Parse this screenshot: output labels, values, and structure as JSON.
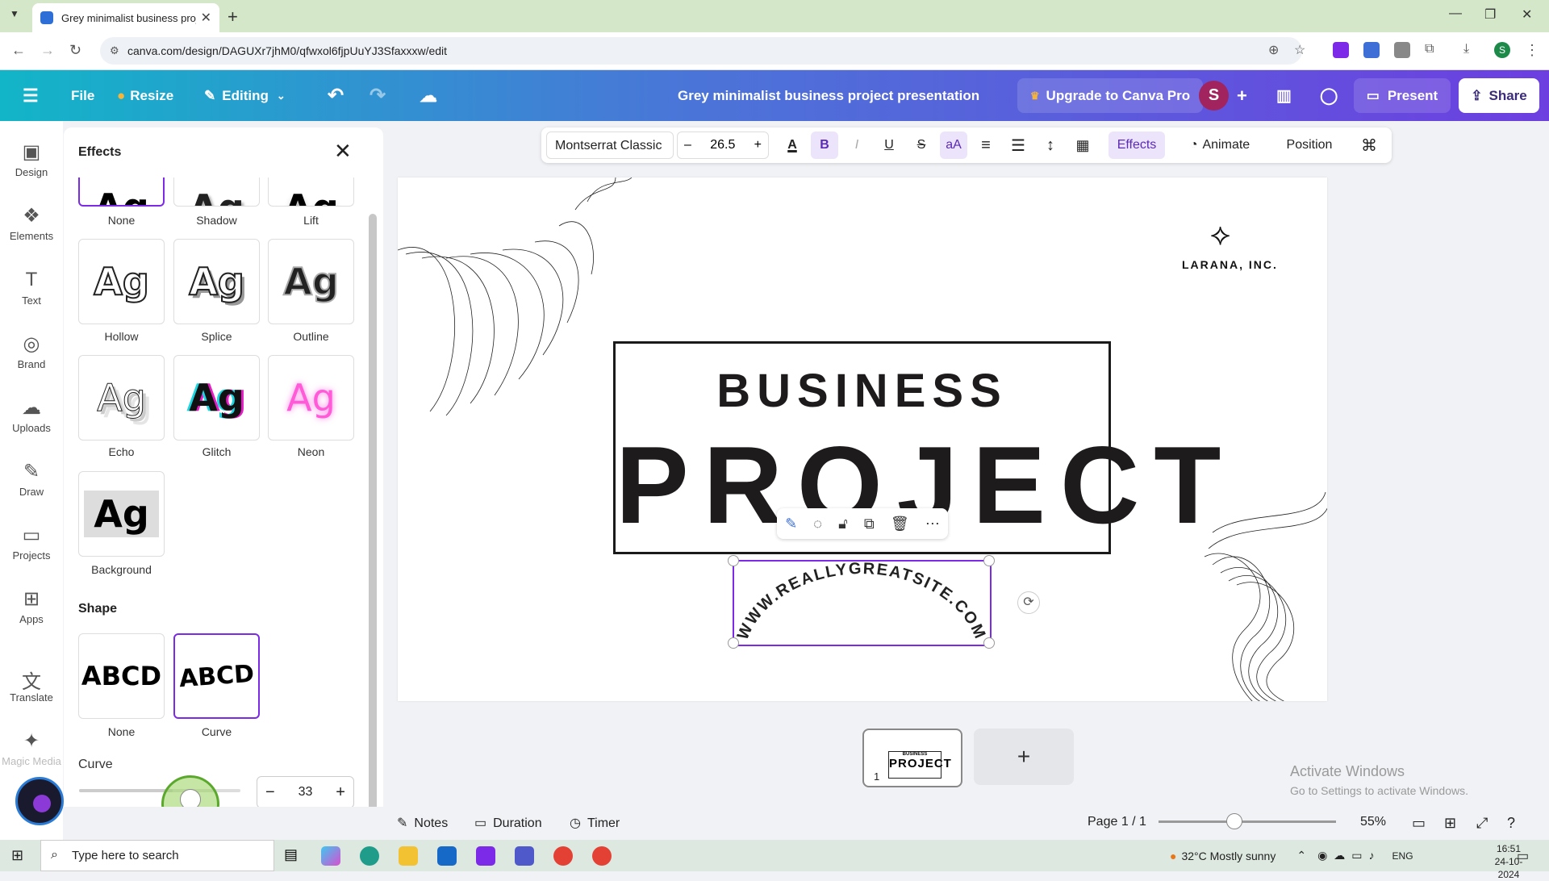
{
  "browser": {
    "tab_title": "Grey minimalist business project",
    "url": "canva.com/design/DAGUXr7jhM0/qfwxol6fjpUuYJ3Sfaxxxw/edit"
  },
  "header": {
    "file": "File",
    "resize": "Resize",
    "editing": "Editing",
    "doc_title": "Grey minimalist business project presentation",
    "upgrade": "Upgrade to Canva Pro",
    "avatar": "S",
    "present": "Present",
    "share": "Share"
  },
  "rail": [
    {
      "label": "Design",
      "icon": "▣"
    },
    {
      "label": "Elements",
      "icon": "❖"
    },
    {
      "label": "Text",
      "icon": "T"
    },
    {
      "label": "Brand",
      "icon": "◎"
    },
    {
      "label": "Uploads",
      "icon": "☁"
    },
    {
      "label": "Draw",
      "icon": "✎"
    },
    {
      "label": "Projects",
      "icon": "▭"
    },
    {
      "label": "Apps",
      "icon": "⊞"
    },
    {
      "label": "Translate",
      "icon": "文"
    },
    {
      "label": "Magic Media",
      "icon": "✦"
    }
  ],
  "panel": {
    "title": "Effects",
    "effects": [
      {
        "label": "None",
        "glyph": "Ag"
      },
      {
        "label": "Shadow",
        "glyph": "Ag"
      },
      {
        "label": "Lift",
        "glyph": "Ag"
      },
      {
        "label": "Hollow",
        "glyph": "Ag"
      },
      {
        "label": "Splice",
        "glyph": "Ag"
      },
      {
        "label": "Outline",
        "glyph": "Ag"
      },
      {
        "label": "Echo",
        "glyph": "Ag"
      },
      {
        "label": "Glitch",
        "glyph": "Ag"
      },
      {
        "label": "Neon",
        "glyph": "Ag"
      },
      {
        "label": "Background",
        "glyph": "Ag"
      }
    ],
    "shape_heading": "Shape",
    "shapes": [
      {
        "label": "None",
        "glyph": "ABCD"
      },
      {
        "label": "Curve",
        "glyph": "ABCD"
      }
    ],
    "curve_heading": "Curve",
    "curve_value": "33",
    "curve_fraction": 0.58
  },
  "toolbar": {
    "font": "Montserrat Classic",
    "size": "26.5",
    "effects": "Effects",
    "animate": "Animate",
    "position": "Position"
  },
  "canvas": {
    "logo_text": "LARANA, INC.",
    "title_line1": "BUSINESS",
    "title_line2": "PROJECT",
    "curved_text": "WWW.REALLYGREATSITE.COM"
  },
  "thumbnail": {
    "line1": "BUSINESS",
    "line2": "PROJECT",
    "number": "1"
  },
  "footer": {
    "notes": "Notes",
    "duration": "Duration",
    "timer": "Timer",
    "page": "Page 1 / 1",
    "zoom": "55%"
  },
  "watermark": {
    "line1": "Activate Windows",
    "line2": "Go to Settings to activate Windows."
  },
  "taskbar": {
    "search_placeholder": "Type here to search",
    "weather": "32°C  Mostly sunny",
    "lang": "ENG",
    "time": "16:51",
    "date": "24-10-2024"
  },
  "colors": {
    "accent": "#7d2ae8",
    "header_start": "#12b5c8",
    "header_end": "#6d3fe0"
  }
}
